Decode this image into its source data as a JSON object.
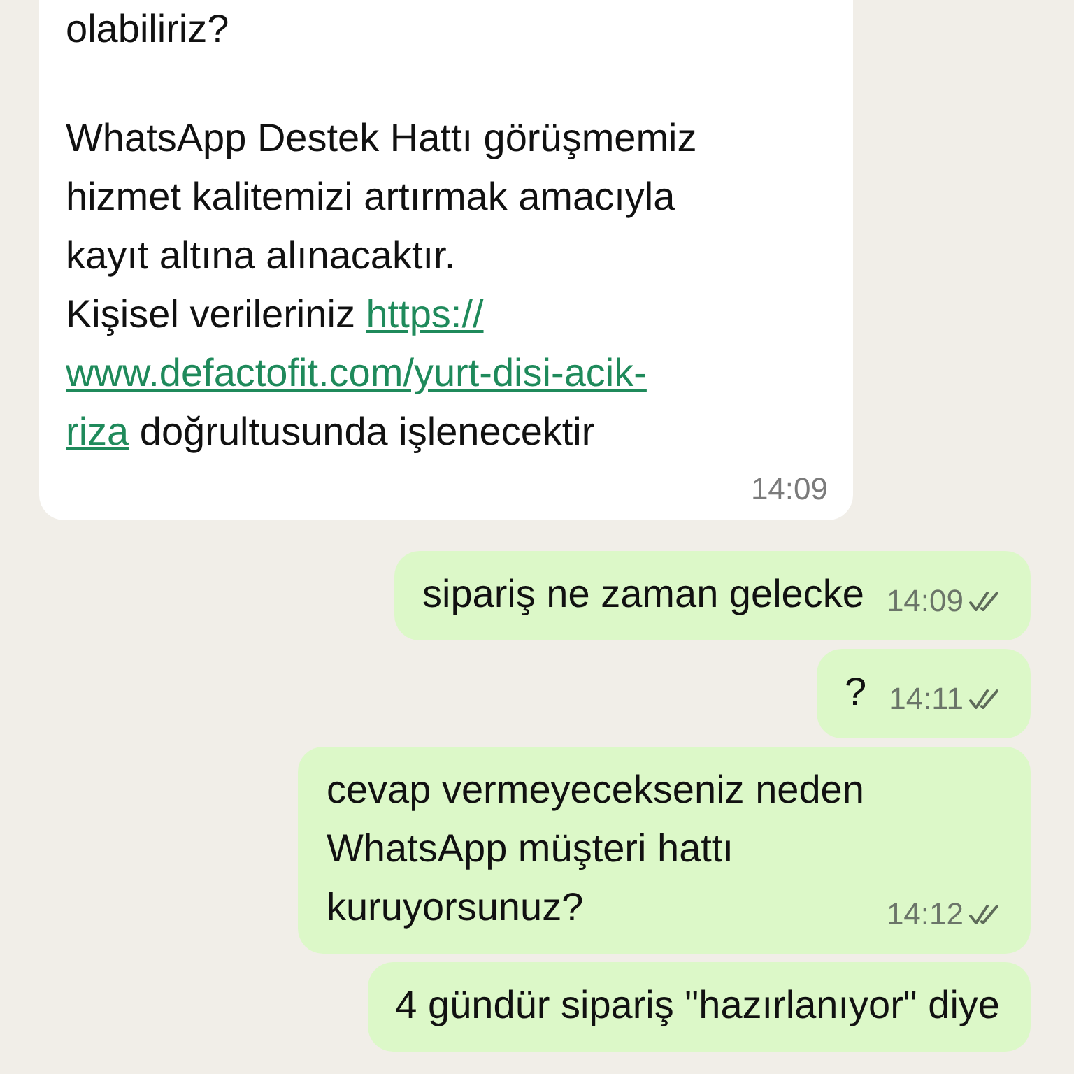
{
  "messages": [
    {
      "kind": "incoming",
      "paragraphs": [
        {
          "lines": [
            [
              {
                "text": "olabiliriz?"
              }
            ]
          ]
        },
        {
          "lines": [
            [
              {
                "text": "WhatsApp Destek Hattı görüşmemiz"
              }
            ],
            [
              {
                "text": "hizmet kalitemizi artırmak amacıyla"
              }
            ],
            [
              {
                "text": "kayıt altına alınacaktır."
              }
            ],
            [
              {
                "text": "Kişisel verileriniz "
              },
              {
                "text": "https://",
                "link": true
              }
            ],
            [
              {
                "text": "www.defactofit.com/yurt-disi-acik-",
                "link": true
              }
            ],
            [
              {
                "text": "riza",
                "link": true
              },
              {
                "text": " doğrultusunda işlenecektir"
              }
            ]
          ]
        }
      ],
      "time": "14:09"
    },
    {
      "kind": "outgoing",
      "paragraphs": [
        {
          "lines": [
            [
              {
                "text": "sipariş ne zaman gelecke"
              }
            ]
          ]
        }
      ],
      "time": "14:09",
      "read": false
    },
    {
      "kind": "outgoing",
      "paragraphs": [
        {
          "lines": [
            [
              {
                "text": "?"
              }
            ]
          ]
        }
      ],
      "time": "14:11",
      "read": false
    },
    {
      "kind": "outgoing",
      "paragraphs": [
        {
          "lines": [
            [
              {
                "text": "cevap vermeyecekseniz neden"
              }
            ],
            [
              {
                "text": "WhatsApp müşteri hattı"
              }
            ],
            [
              {
                "text": "kuruyorsunuz?"
              }
            ]
          ]
        }
      ],
      "time": "14:12",
      "read": false
    },
    {
      "kind": "outgoing",
      "paragraphs": [
        {
          "lines": [
            [
              {
                "text": "4 gündür sipariş \"hazırlanıyor\" diye"
              }
            ]
          ]
        }
      ]
    }
  ]
}
